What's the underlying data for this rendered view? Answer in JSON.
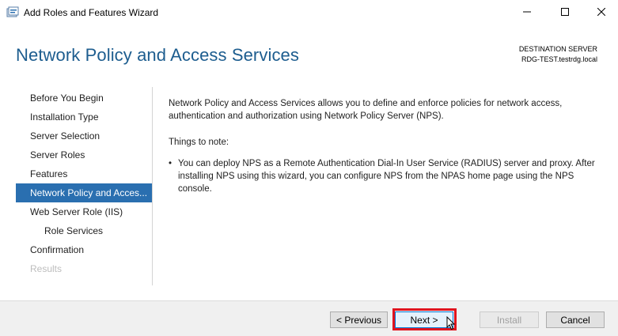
{
  "window": {
    "title": "Add Roles and Features Wizard"
  },
  "header": {
    "page_title": "Network Policy and Access Services",
    "destination_label": "DESTINATION SERVER",
    "destination_server": "RDG-TEST.testrdg.local"
  },
  "sidebar": {
    "items": [
      {
        "label": "Before You Begin",
        "state": "normal"
      },
      {
        "label": "Installation Type",
        "state": "normal"
      },
      {
        "label": "Server Selection",
        "state": "normal"
      },
      {
        "label": "Server Roles",
        "state": "normal"
      },
      {
        "label": "Features",
        "state": "normal"
      },
      {
        "label": "Network Policy and Acces...",
        "state": "active"
      },
      {
        "label": "Web Server Role (IIS)",
        "state": "normal"
      },
      {
        "label": "Role Services",
        "state": "sub"
      },
      {
        "label": "Confirmation",
        "state": "normal"
      },
      {
        "label": "Results",
        "state": "disabled"
      }
    ]
  },
  "content": {
    "intro": "Network Policy and Access Services allows you to define and enforce policies for network access, authentication and authorization using Network Policy Server (NPS).",
    "things_to_note": "Things to note:",
    "bullet_symbol": "•",
    "bullet_text": "You can deploy NPS as a Remote Authentication Dial-In User Service (RADIUS) server and proxy. After installing NPS using this wizard,  you can configure NPS from the NPAS home page using the NPS console."
  },
  "footer": {
    "previous_label": "< Previous",
    "next_label": "Next >",
    "install_label": "Install",
    "cancel_label": "Cancel"
  },
  "colors": {
    "title_blue": "#1d5d8f",
    "nav_active_bg": "#2a6fb0",
    "highlight_red": "#e0141e",
    "disabled_text": "#bdbdbd"
  },
  "icons": {
    "app": "server-manager-icon",
    "minimize": "minimize-icon",
    "maximize": "maximize-icon",
    "close": "close-icon",
    "cursor": "mouse-pointer-icon"
  }
}
